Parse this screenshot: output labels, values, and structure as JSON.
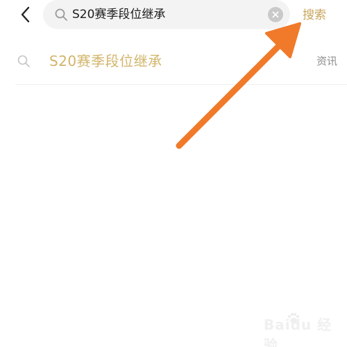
{
  "header": {
    "search_value": "S20赛季段位继承",
    "search_button_label": "搜索"
  },
  "suggestions": [
    {
      "text": "S20赛季段位继承",
      "tag": "资讯"
    }
  ],
  "watermark": {
    "text": "Baidu 经验"
  },
  "colors": {
    "accent": "#c8a55c",
    "suggestion_text": "#d2b46a",
    "arrow": "#f07a2a"
  }
}
